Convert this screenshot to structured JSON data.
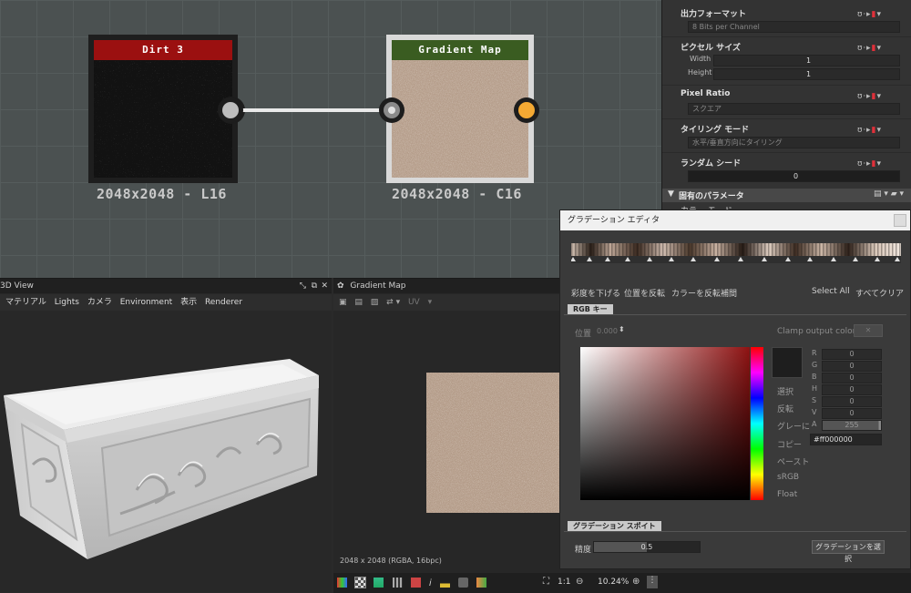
{
  "graph": {
    "node1": {
      "title": "Dirt 3",
      "resolution": "2048x2048 - L16",
      "title_color": "#9b1010"
    },
    "node2": {
      "title": "Gradient Map",
      "resolution": "2048x2048 - C16",
      "title_color": "#3a5c21"
    },
    "ports": {
      "output_gray": "#bdbdbd",
      "input": "#8a8a8a",
      "output_orange": "#f4a933"
    }
  },
  "props": {
    "output_format": {
      "label": "出力フォーマット",
      "value": "8 Bits per Channel"
    },
    "pixel_size": {
      "label": "ピクセル サイズ",
      "width_label": "Width",
      "height_label": "Height",
      "width_value": "1",
      "height_value": "1"
    },
    "pixel_ratio": {
      "label": "Pixel Ratio",
      "value": "スクエア"
    },
    "tiling_mode": {
      "label": "タイリング モード",
      "value": "水平/垂直方向にタイリング"
    },
    "random_seed": {
      "label": "ランダム シード",
      "value": "0"
    },
    "section": "固有のパラメータ",
    "color_mode": "カラー モード"
  },
  "view3d": {
    "title": "3D View",
    "menu": [
      "マテリアル",
      "Lights",
      "カメラ",
      "Environment",
      "表示",
      "Renderer"
    ]
  },
  "view2d": {
    "title": "Gradient Map",
    "toolbar_uv": "UV",
    "status": "2048 x 2048 (RGBA, 16bpc)",
    "zoom": "10.24%",
    "ratio": "1:1"
  },
  "gradient_editor": {
    "title": "グラデーション エディタ",
    "buttons": [
      "彩度を下げる",
      "位置を反転",
      "カラーを反転",
      "補間"
    ],
    "select_all": "Select All",
    "clear_all": "すべてクリア",
    "tab_rgb": "RGB キー",
    "position_label": "位置",
    "position_value": "0.000",
    "clamp_label": "Clamp output color",
    "side_buttons": [
      "選択",
      "反転",
      "グレーに",
      "コピー",
      "ペースト",
      "sRGB",
      "Float"
    ],
    "channels": [
      {
        "label": "R",
        "value": "0"
      },
      {
        "label": "G",
        "value": "0"
      },
      {
        "label": "B",
        "value": "0"
      },
      {
        "label": "H",
        "value": "0"
      },
      {
        "label": "S",
        "value": "0"
      },
      {
        "label": "V",
        "value": "0"
      },
      {
        "label": "A",
        "value": "255"
      }
    ],
    "hex": "#ff000000",
    "eyedropper_tab": "グラデーション スポイト",
    "precision_label": "精度",
    "precision_value": "0.5",
    "select_gradient": "グラデーションを選択"
  }
}
